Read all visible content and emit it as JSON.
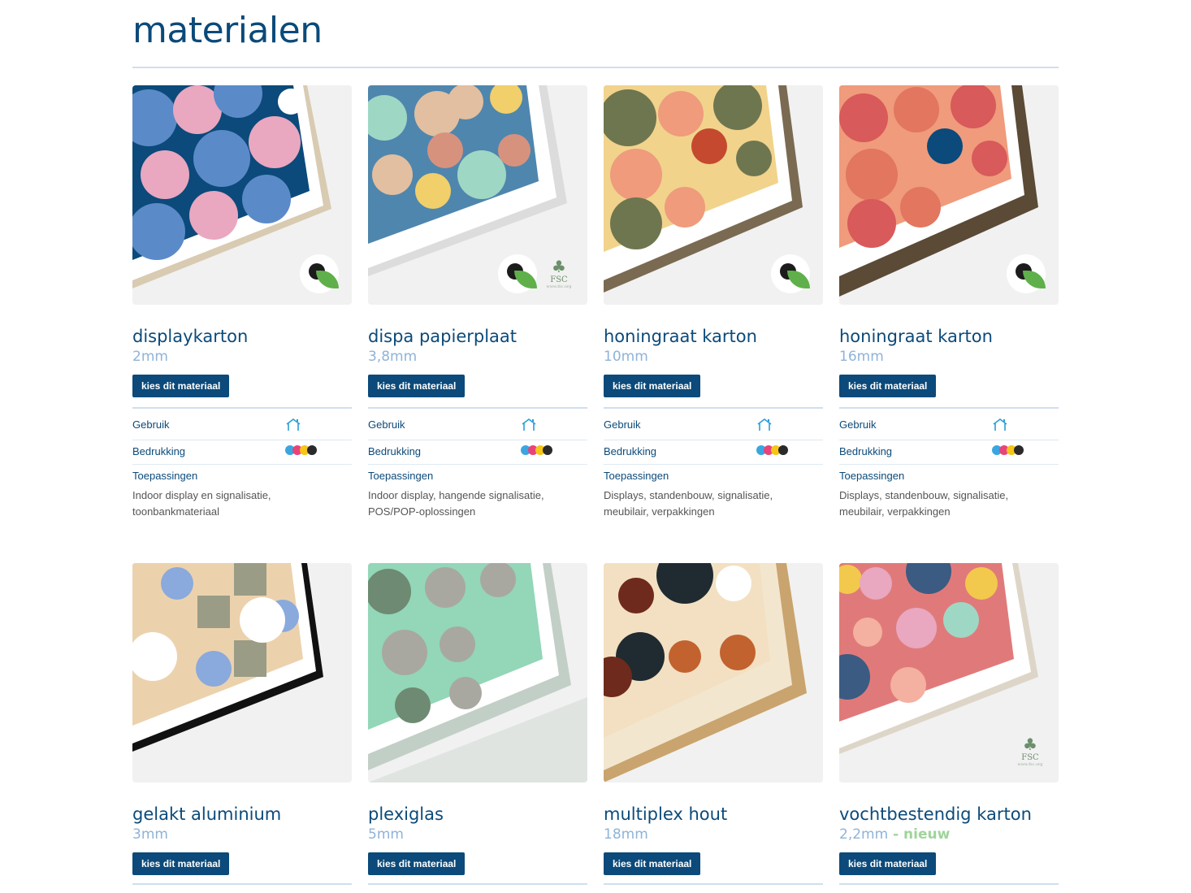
{
  "page": {
    "title": "materialen"
  },
  "labels": {
    "cta": "kies dit materiaal",
    "usage": "Gebruik",
    "printing": "Bedrukking",
    "applications": "Toepassingen"
  },
  "colors": {
    "brand": "#0b4a7a",
    "spec": "#8fb3d9",
    "new_badge": "#9fd49a",
    "divider": "#cfdfee"
  },
  "icons": {
    "usage": "indoor-house-icon",
    "printing": "cmyk-dots-icon",
    "eco": "eco-leaf-icon",
    "fsc": "fsc-logo"
  },
  "fsc_text": "FSC",
  "fsc_url": "www.fsc.org",
  "materials": [
    {
      "name": "displaykarton",
      "thickness": "2mm",
      "applications_text": [
        "Indoor display en signalisatie,",
        "toonbankmateriaal"
      ],
      "eco": true,
      "fsc": false
    },
    {
      "name": "dispa papierplaat",
      "thickness": "3,8mm",
      "applications_text": [
        "Indoor display, hangende signalisatie,",
        "POS/POP-oplossingen"
      ],
      "eco": true,
      "fsc": true
    },
    {
      "name": "honingraat karton",
      "thickness": "10mm",
      "applications_text": [
        "Displays, standenbouw, signalisatie,",
        "meubilair, verpakkingen"
      ],
      "eco": true,
      "fsc": false
    },
    {
      "name": "honingraat karton",
      "thickness": "16mm",
      "applications_text": [
        "Displays, standenbouw, signalisatie,",
        "meubilair, verpakkingen"
      ],
      "eco": true,
      "fsc": false
    },
    {
      "name": "gelakt aluminium",
      "thickness": "3mm",
      "eco": false,
      "fsc": false
    },
    {
      "name": "plexiglas",
      "thickness": "5mm",
      "eco": false,
      "fsc": false
    },
    {
      "name": "multiplex hout",
      "thickness": "18mm",
      "eco": false,
      "fsc": false
    },
    {
      "name": "vochtbestendig karton",
      "thickness": "2,2mm",
      "badge": " - nieuw",
      "eco": false,
      "fsc": true
    }
  ]
}
